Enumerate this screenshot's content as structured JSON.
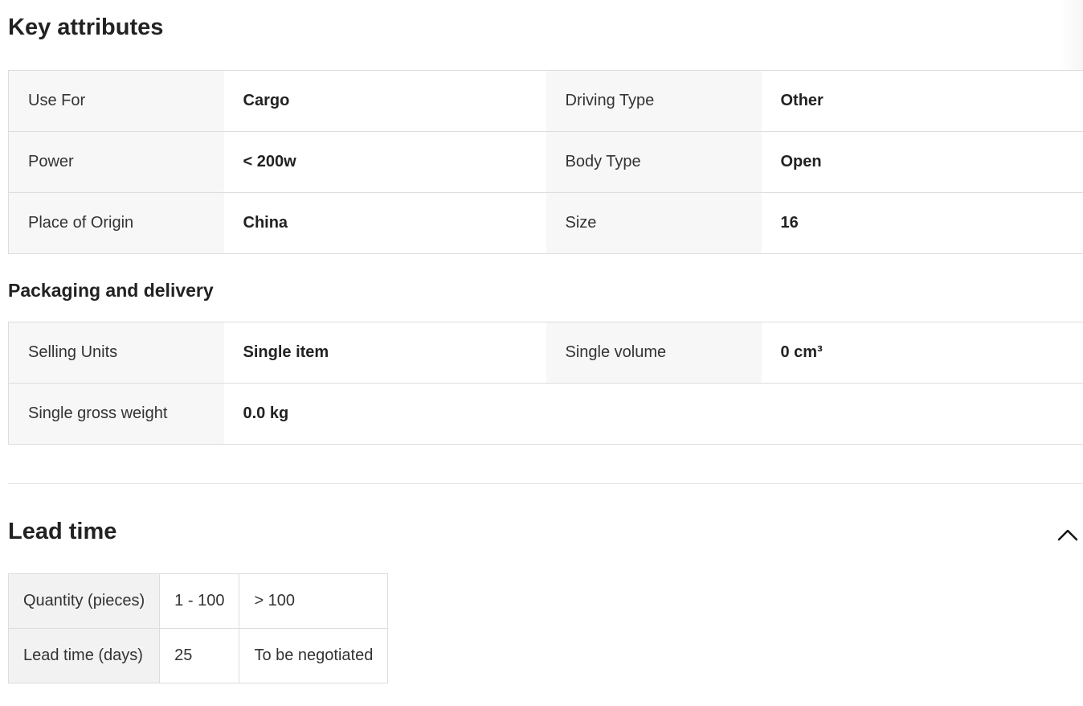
{
  "key_attributes": {
    "title": "Key attributes",
    "rows": [
      [
        {
          "label": "Use For",
          "value": "Cargo"
        },
        {
          "label": "Driving Type",
          "value": "Other"
        }
      ],
      [
        {
          "label": "Power",
          "value": "< 200w"
        },
        {
          "label": "Body Type",
          "value": "Open"
        }
      ],
      [
        {
          "label": "Place of Origin",
          "value": "China"
        },
        {
          "label": "Size",
          "value": "16"
        }
      ]
    ]
  },
  "packaging": {
    "title": "Packaging and delivery",
    "rows": [
      [
        {
          "label": "Selling Units",
          "value": "Single item"
        },
        {
          "label": "Single volume",
          "value": "0 cm³"
        }
      ],
      [
        {
          "label": "Single gross weight",
          "value": "0.0 kg"
        }
      ]
    ]
  },
  "lead_time": {
    "title": "Lead time",
    "toggle_icon": "chevron-up-icon",
    "quantity_label": "Quantity (pieces)",
    "quantity_ranges": [
      "1 - 100",
      "> 100"
    ],
    "days_label": "Lead time (days)",
    "days_values": [
      "25",
      "To be negotiated"
    ]
  }
}
